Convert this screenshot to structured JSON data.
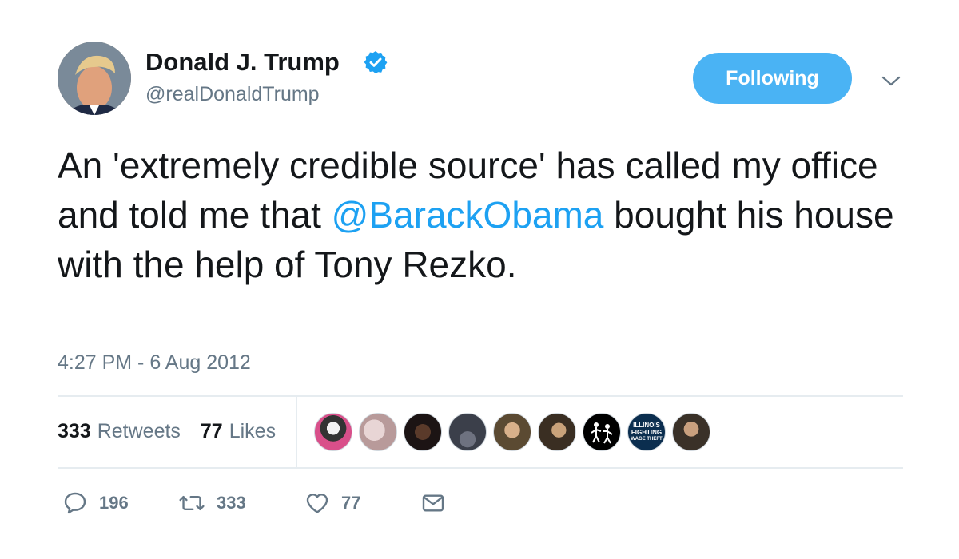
{
  "author": {
    "display_name": "Donald J. Trump",
    "handle": "@realDonaldTrump",
    "verified": true
  },
  "follow_button": {
    "label": "Following"
  },
  "tweet": {
    "text_before": "An 'extremely credible source' has called my office and told me that ",
    "mention": "@BarackObama",
    "text_after": " bought his house with the help of Tony Rezko.",
    "timestamp": "4:27 PM - 6 Aug 2012"
  },
  "stats": {
    "retweets_count": "333",
    "retweets_label": "Retweets",
    "likes_count": "77",
    "likes_label": "Likes"
  },
  "likers": {
    "illinois_badge": [
      "ILLINOIS",
      "FIGHTING",
      "WAGE THEFT"
    ]
  },
  "actions": {
    "reply_count": "196",
    "retweet_count": "333",
    "like_count": "77"
  },
  "colors": {
    "accent": "#1da1f2",
    "button_bg": "#4ab3f4",
    "muted": "#657786",
    "text": "#14171a"
  },
  "icons": {
    "verified": "verified-badge-icon",
    "caret": "chevron-down-icon",
    "reply": "reply-icon",
    "retweet": "retweet-icon",
    "like": "heart-icon",
    "message": "envelope-icon"
  }
}
